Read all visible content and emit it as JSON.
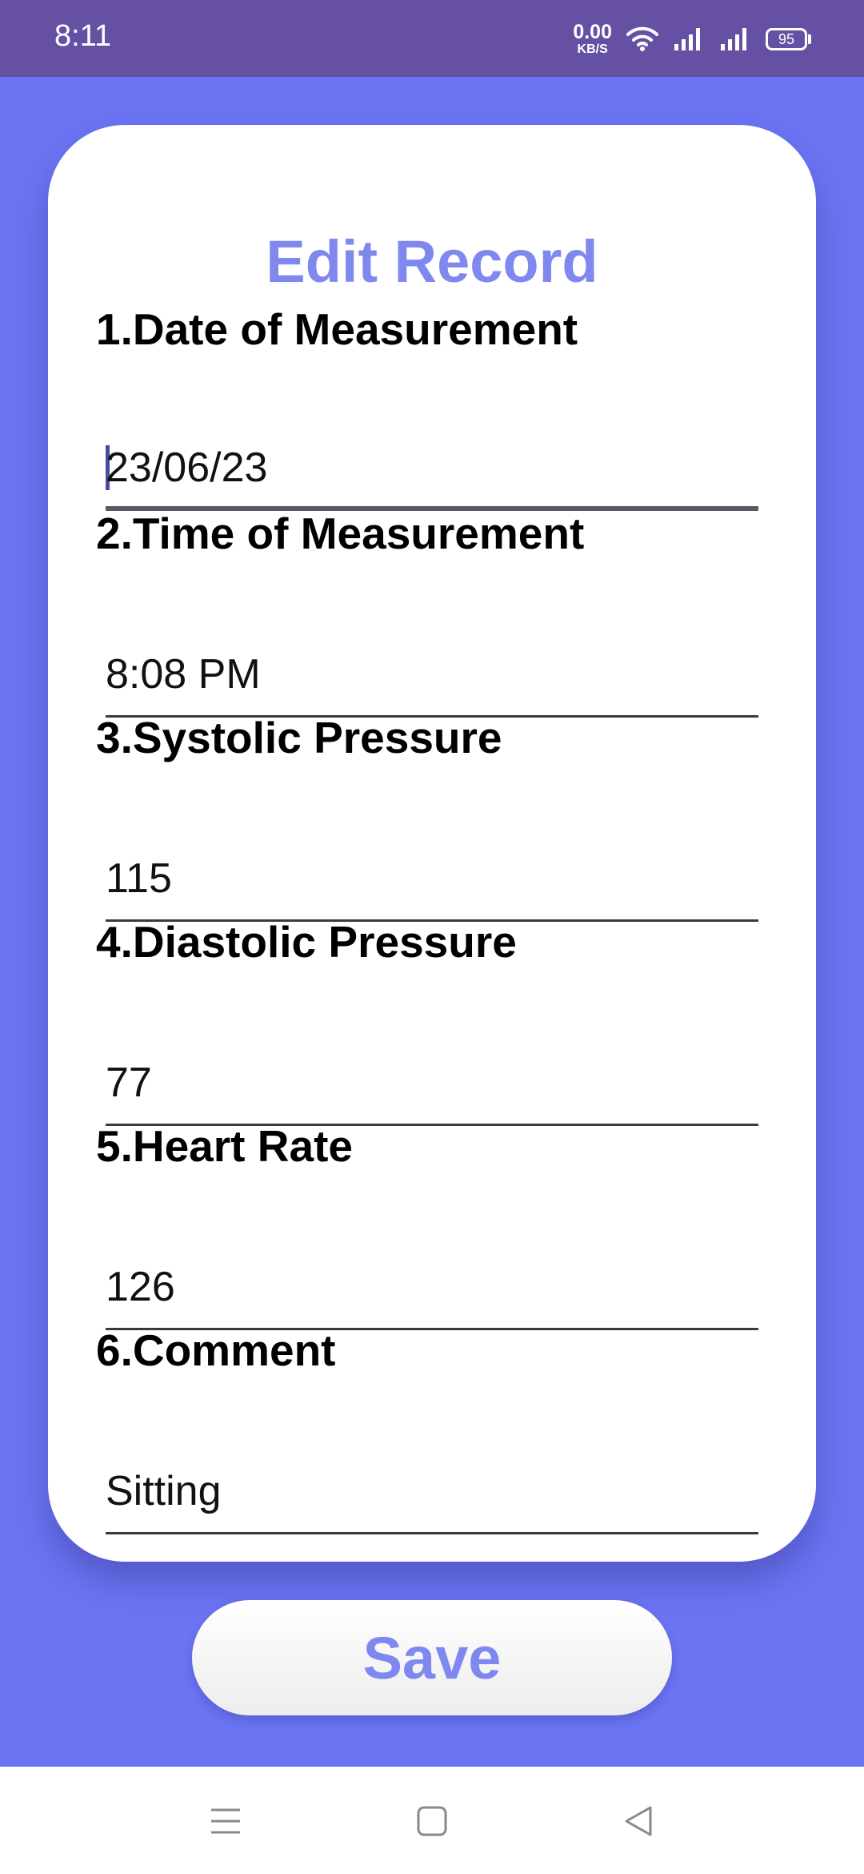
{
  "status_bar": {
    "time": "8:11",
    "net_speed_value": "0.00",
    "net_speed_unit": "KB/S",
    "battery": "95"
  },
  "card": {
    "title": "Edit Record"
  },
  "fields": [
    {
      "label": "1.Date of Measurement",
      "value": "23/06/23"
    },
    {
      "label": "2.Time of Measurement",
      "value": "8:08 PM"
    },
    {
      "label": "3.Systolic Pressure",
      "value": "115"
    },
    {
      "label": "4.Diastolic Pressure",
      "value": "77"
    },
    {
      "label": "5.Heart Rate",
      "value": "126"
    },
    {
      "label": "6.Comment",
      "value": "Sitting"
    }
  ],
  "save_label": "Save",
  "nav_bar": {
    "icons": [
      "menu-icon",
      "home-square-icon",
      "back-triangle-icon"
    ]
  },
  "colors": {
    "status_bar": "#6550a4",
    "background": "#6b74f3",
    "accent_text": "#7f88ee",
    "card": "#ffffff"
  }
}
